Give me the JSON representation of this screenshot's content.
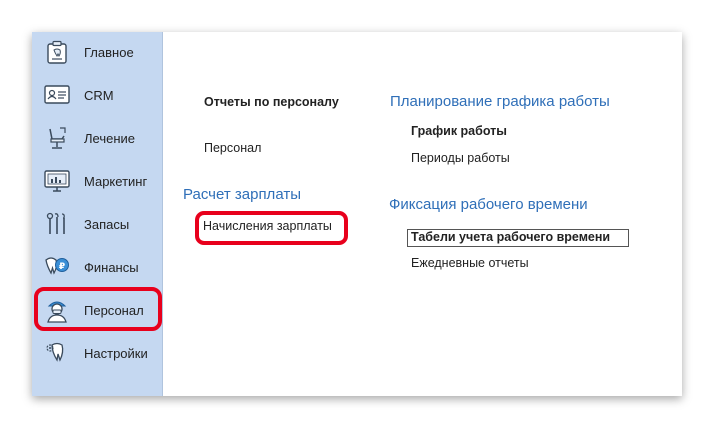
{
  "sidebar": {
    "items": [
      {
        "id": "main",
        "label": "Главное",
        "icon": "tooth-clipboard-icon"
      },
      {
        "id": "crm",
        "label": "CRM",
        "icon": "contact-card-icon"
      },
      {
        "id": "treatment",
        "label": "Лечение",
        "icon": "dental-chair-icon"
      },
      {
        "id": "marketing",
        "label": "Маркетинг",
        "icon": "monitor-chart-icon"
      },
      {
        "id": "stock",
        "label": "Запасы",
        "icon": "dental-tools-icon"
      },
      {
        "id": "finance",
        "label": "Финансы",
        "icon": "tooth-coin-icon"
      },
      {
        "id": "staff",
        "label": "Персонал",
        "icon": "doctor-avatar-icon",
        "selected": true
      },
      {
        "id": "settings",
        "label": "Настройки",
        "icon": "tooth-gear-icon"
      }
    ]
  },
  "content": {
    "col1": {
      "report_link": "Отчеты по персоналу",
      "staff_link": "Персонал",
      "salary_title": "Расчет зарплаты",
      "salary_link": "Начисления зарплаты"
    },
    "col2": {
      "schedule_title": "Планирование графика работы",
      "schedule_link": "График работы",
      "periods_link": "Периоды работы",
      "timetrack_title": "Фиксация рабочего времени",
      "timesheet_link": "Табели учета рабочего времени",
      "daily_link": "Ежедневные отчеты"
    }
  },
  "colors": {
    "sidebar_bg": "#c5d8f1",
    "group_title": "#2f6fb8",
    "highlight": "#e8001c"
  }
}
